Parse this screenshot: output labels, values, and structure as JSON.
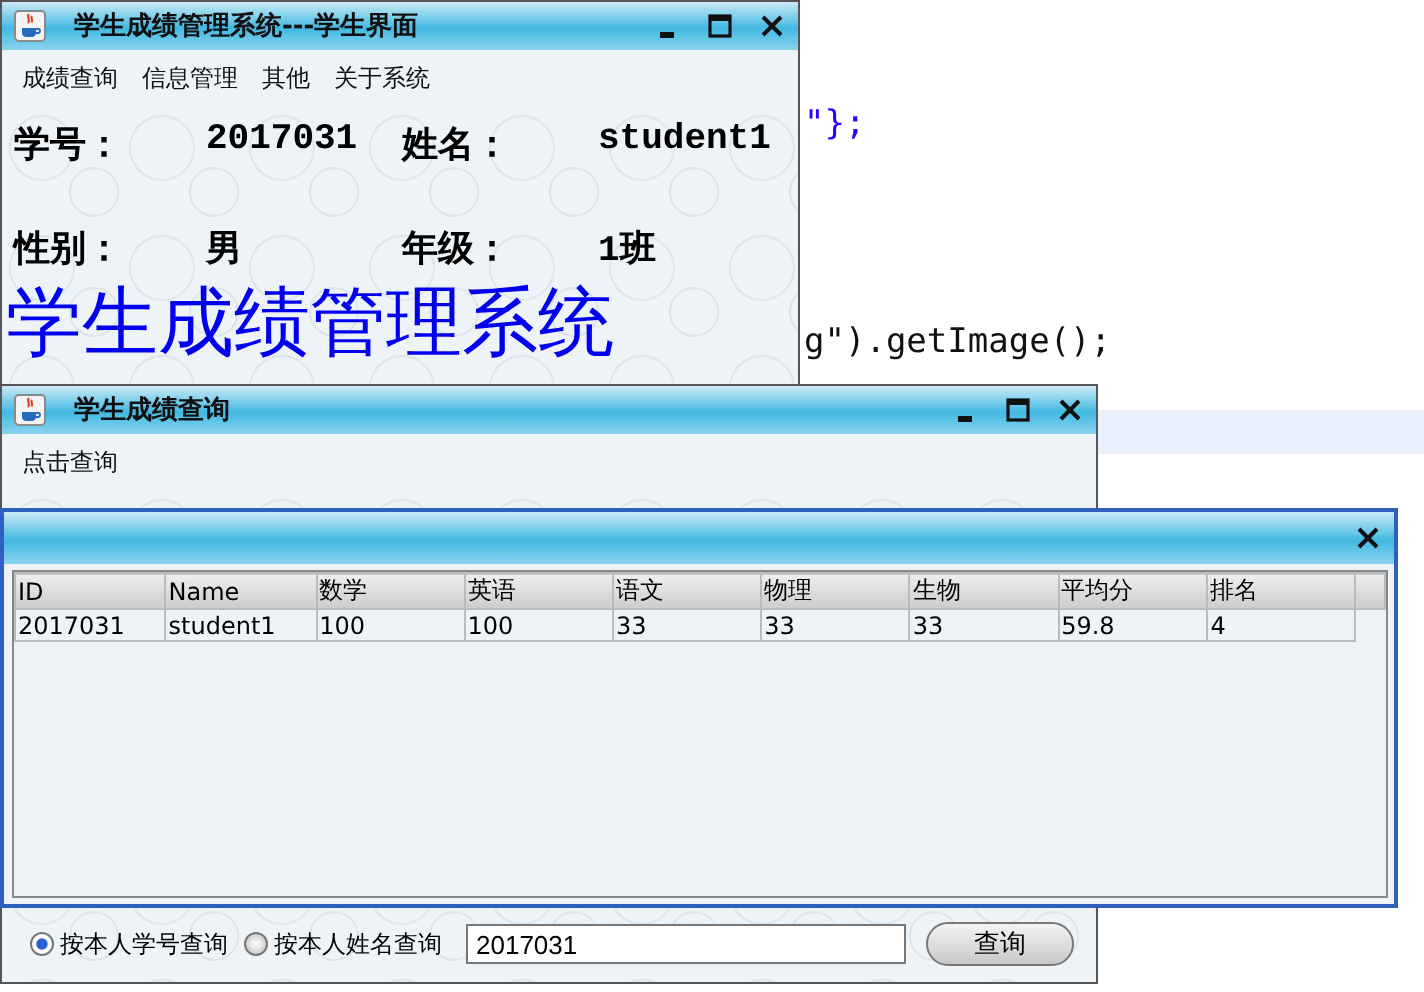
{
  "editor": {
    "code_lines": [
      "\"};",
      "g\").getImage();"
    ]
  },
  "main_window": {
    "title": "学生成绩管理系统---学生界面",
    "menu": [
      "成绩查询",
      "信息管理",
      "其他",
      "关于系统"
    ],
    "fields": [
      {
        "label": "学号：",
        "value": "2017031"
      },
      {
        "label": "姓名：",
        "value": "student1"
      },
      {
        "label": "性别：",
        "value": "男"
      },
      {
        "label": "年级：",
        "value": "1班"
      }
    ],
    "banner": "学生成绩管理系统"
  },
  "query_window": {
    "title": "学生成绩查询",
    "menu": [
      "点击查询"
    ],
    "options": [
      {
        "label": "按本人学号查询",
        "selected": true
      },
      {
        "label": "按本人姓名查询",
        "selected": false
      }
    ],
    "query_input": {
      "value": "2017031"
    },
    "query_button": "查询"
  },
  "result_dialog": {
    "table": {
      "columns": [
        "ID",
        "Name",
        "数学",
        "英语",
        "语文",
        "物理",
        "生物",
        "平均分",
        "排名"
      ],
      "rows": [
        [
          "2017031",
          "student1",
          "100",
          "100",
          "33",
          "33",
          "33",
          "59.8",
          "4"
        ]
      ]
    }
  }
}
